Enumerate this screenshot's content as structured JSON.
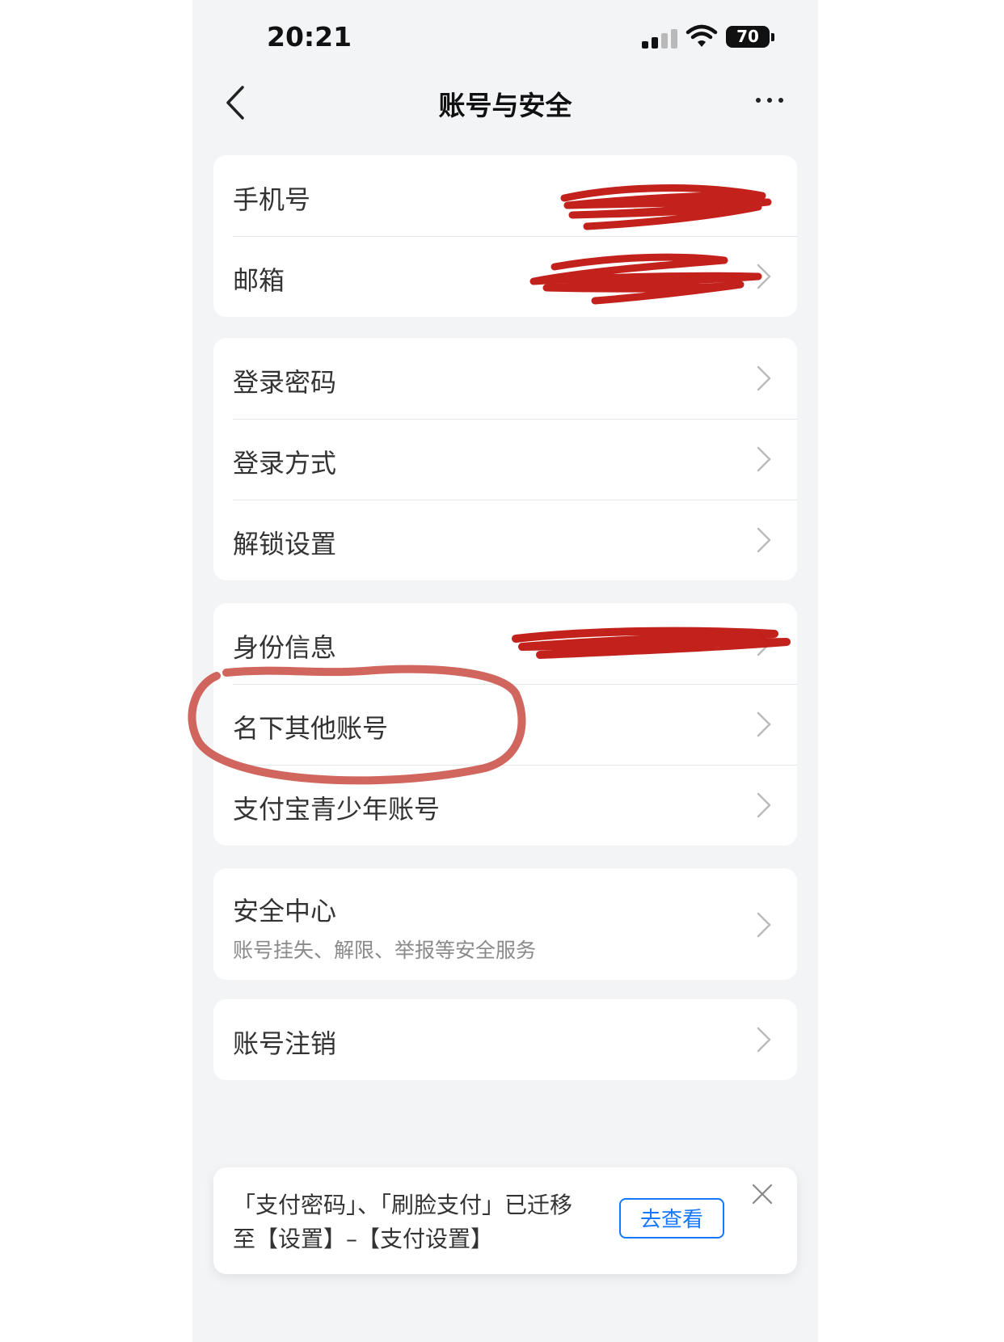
{
  "status_bar": {
    "time": "20:21",
    "battery": "70"
  },
  "navbar": {
    "title": "账号与安全"
  },
  "groups": {
    "contact": {
      "items": [
        {
          "label": "手机号"
        },
        {
          "label": "邮箱"
        }
      ]
    },
    "login": {
      "items": [
        {
          "label": "登录密码"
        },
        {
          "label": "登录方式"
        },
        {
          "label": "解锁设置"
        }
      ]
    },
    "identity": {
      "items": [
        {
          "label": "身份信息"
        },
        {
          "label": "名下其他账号"
        },
        {
          "label": "支付宝青少年账号"
        }
      ]
    },
    "security": {
      "label": "安全中心",
      "sub": "账号挂失、解限、举报等安全服务"
    },
    "cancel": {
      "label": "账号注销"
    }
  },
  "banner": {
    "message": "「支付密码」、「刷脸支付」已迁移至【设置】–【支付设置】",
    "button_label": "去查看"
  },
  "colors": {
    "accent": "#1677ff",
    "redaction": "#c0150f",
    "circle": "#c94b42"
  }
}
